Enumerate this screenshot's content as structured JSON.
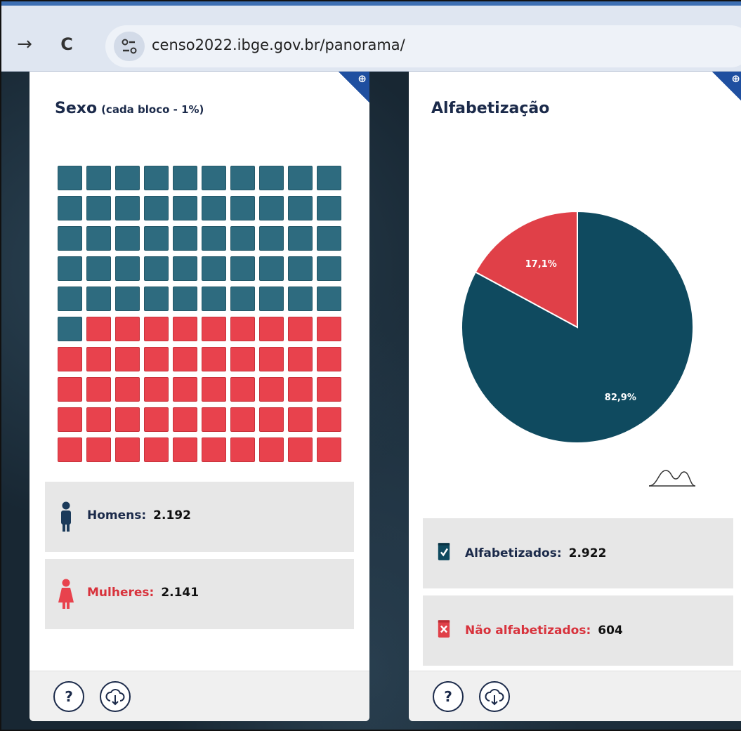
{
  "browser": {
    "url": "censo2022.ibge.gov.br/panorama/",
    "forward_icon": "→",
    "reload_icon": "C"
  },
  "colors": {
    "men": "#2e6b7f",
    "women": "#e8424d",
    "literate": "#0f4a5f",
    "illiterate": "#e04048",
    "title": "#1b2a4a"
  },
  "sexo": {
    "title": "Sexo",
    "subtitle": "(cada bloco - 1%)",
    "waffle_men_blocks": 51,
    "waffle_total_blocks": 100,
    "men_label": "Homens:",
    "men_value": "2.192",
    "women_label": "Mulheres:",
    "women_value": "2.141",
    "help_label": "?"
  },
  "alfabetizacao": {
    "title": "Alfabetização",
    "literate_label": "Alfabetizados:",
    "literate_value": "2.922",
    "illiterate_label": "Não alfabetizados:",
    "illiterate_value": "604",
    "help_label": "?"
  },
  "chart_data": {
    "type": "pie",
    "slices": [
      {
        "name": "Alfabetizados",
        "value": 82.9,
        "label": "82,9%"
      },
      {
        "name": "Não alfabetizados",
        "value": 17.1,
        "label": "17,1%"
      }
    ]
  }
}
